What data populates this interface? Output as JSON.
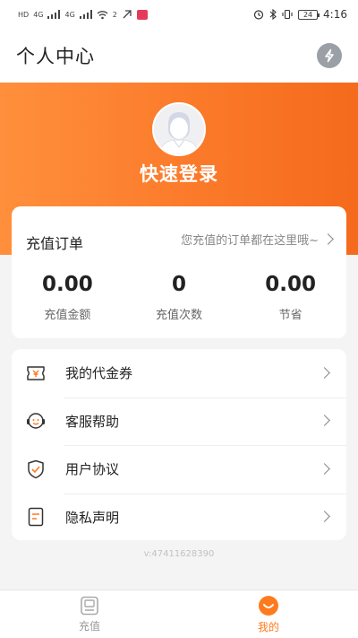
{
  "status_bar": {
    "left_labels": [
      "HD",
      "4G",
      "4G",
      "2"
    ],
    "battery": "24",
    "time": "4:16"
  },
  "header": {
    "title": "个人中心",
    "action_icon": "flash-icon"
  },
  "profile": {
    "login_label": "快速登录",
    "avatar_icon": "default-avatar-icon"
  },
  "recharge_card": {
    "title": "充值订单",
    "hint": "您充值的订单都在这里哦~",
    "stats": [
      {
        "value": "0.00",
        "label": "充值金额"
      },
      {
        "value": "0",
        "label": "充值次数"
      },
      {
        "value": "0.00",
        "label": "节省"
      }
    ]
  },
  "menu": {
    "items": [
      {
        "label": "我的代金券",
        "icon": "voucher-icon"
      },
      {
        "label": "客服帮助",
        "icon": "customer-service-icon"
      },
      {
        "label": "用户协议",
        "icon": "shield-check-icon"
      },
      {
        "label": "隐私声明",
        "icon": "document-icon"
      }
    ]
  },
  "version": "v:47411628390",
  "bottom_nav": {
    "items": [
      {
        "label": "充值",
        "icon": "recharge-icon",
        "active": false
      },
      {
        "label": "我的",
        "icon": "smile-icon",
        "active": true
      }
    ]
  },
  "colors": {
    "accent": "#ff7a1f",
    "banner_start": "#ff8f3c",
    "banner_end": "#f56a1c"
  }
}
